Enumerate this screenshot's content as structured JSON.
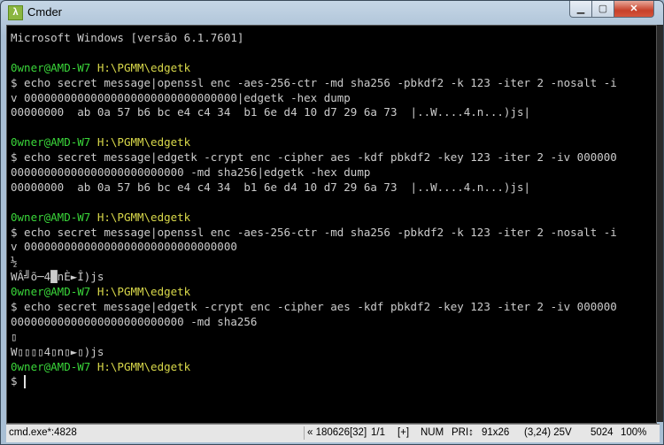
{
  "window": {
    "title": "Cmder",
    "icon_glyph": "λ",
    "controls": {
      "minimize": "▁",
      "maximize": "▢",
      "close": "✕"
    }
  },
  "console": {
    "lines": [
      {
        "type": "text",
        "text": "Microsoft Windows [versão 6.1.7601]"
      },
      {
        "type": "blank"
      },
      {
        "type": "prompt",
        "user": "0wner@AMD-W7",
        "path": "H:\\PGMM\\edgetk"
      },
      {
        "type": "text",
        "text": "$ echo secret message|openssl enc -aes-256-ctr -md sha256 -pbkdf2 -k 123 -iter 2 -nosalt -i"
      },
      {
        "type": "text",
        "text": "v 00000000000000000000000000000000|edgetk -hex dump"
      },
      {
        "type": "text",
        "text": "00000000  ab 0a 57 b6 bc e4 c4 34  b1 6e d4 10 d7 29 6a 73  |..W....4.n...)js|"
      },
      {
        "type": "blank"
      },
      {
        "type": "prompt",
        "user": "0wner@AMD-W7",
        "path": "H:\\PGMM\\edgetk"
      },
      {
        "type": "text",
        "text": "$ echo secret message|edgetk -crypt enc -cipher aes -kdf pbkdf2 -key 123 -iter 2 -iv 000000"
      },
      {
        "type": "text",
        "text": "00000000000000000000000000 -md sha256|edgetk -hex dump"
      },
      {
        "type": "text",
        "text": "00000000  ab 0a 57 b6 bc e4 c4 34  b1 6e d4 10 d7 29 6a 73  |..W....4.n...)js|"
      },
      {
        "type": "blank"
      },
      {
        "type": "prompt",
        "user": "0wner@AMD-W7",
        "path": "H:\\PGMM\\edgetk"
      },
      {
        "type": "text",
        "text": "$ echo secret message|openssl enc -aes-256-ctr -md sha256 -pbkdf2 -k 123 -iter 2 -nosalt -i"
      },
      {
        "type": "text",
        "text": "v 00000000000000000000000000000000"
      },
      {
        "type": "text",
        "text": "½"
      },
      {
        "type": "text",
        "text": "WÂ╝õ─4█nÈ►Î)js"
      },
      {
        "type": "prompt",
        "user": "0wner@AMD-W7",
        "path": "H:\\PGMM\\edgetk"
      },
      {
        "type": "text",
        "text": "$ echo secret message|edgetk -crypt enc -cipher aes -kdf pbkdf2 -key 123 -iter 2 -iv 000000"
      },
      {
        "type": "text",
        "text": "00000000000000000000000000 -md sha256"
      },
      {
        "type": "text",
        "text": "▯"
      },
      {
        "type": "text",
        "text": "W▯▯▯▯4▯n▯►▯)js"
      },
      {
        "type": "prompt",
        "user": "0wner@AMD-W7",
        "path": "H:\\PGMM\\edgetk"
      },
      {
        "type": "input",
        "text": "$ "
      }
    ]
  },
  "status": {
    "process": "cmd.exe*:4828",
    "buffer": "« 180626[32]",
    "tab": "1/1",
    "insert": "[+]",
    "numlock": "NUM",
    "priority": "PRI↕",
    "size": "91x26",
    "cursor_pos": "(3,24) 25V",
    "pid": "5024",
    "zoom": "100%"
  },
  "colors": {
    "prompt_user": "#3ad63a",
    "prompt_path": "#d8d84a",
    "text": "#cccccc",
    "background": "#000000"
  }
}
